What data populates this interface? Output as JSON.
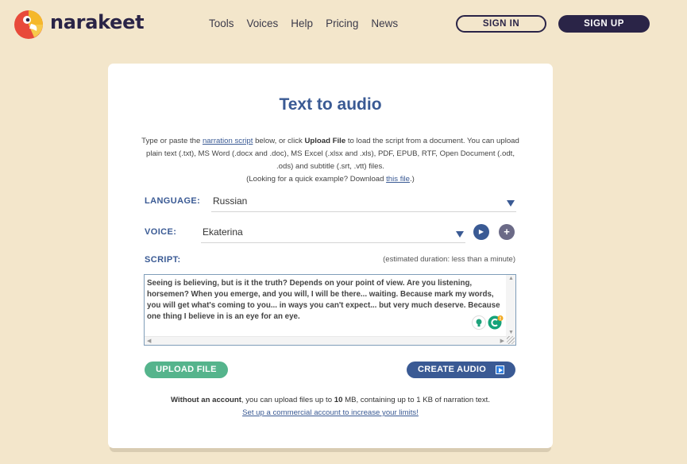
{
  "header": {
    "brand": "narakeet",
    "nav": [
      "Tools",
      "Voices",
      "Help",
      "Pricing",
      "News"
    ],
    "sign_in": "SIGN IN",
    "sign_up": "SIGN UP"
  },
  "card": {
    "title": "Text to audio",
    "intro": {
      "p1_before": "Type or paste the ",
      "p1_link": "narration script",
      "p1_mid": " below, or click ",
      "p1_bold": "Upload File",
      "p1_after": " to load the script from a document. You can upload plain text (.txt), MS Word (.docx and .doc), MS Excel (.xlsx and .xls), PDF, EPUB, RTF, Open Document (.odt, .ods) and subtitle (.srt, .vtt) files.",
      "p2_before": "(Looking for a quick example? Download ",
      "p2_link": "this file",
      "p2_after": ".)"
    },
    "language": {
      "label": "LANGUAGE:",
      "value": "Russian"
    },
    "voice": {
      "label": "VOICE:",
      "value": "Ekaterina"
    },
    "script": {
      "label": "SCRIPT:",
      "duration": "(estimated duration: less than a minute)",
      "text": "Seeing is believing, but is it the truth? Depends on your point of view. Are you listening, horsemen? When you emerge, and you will, I will be there... waiting. Because mark my words, you will get what's coming to you... in ways you can't expect... but very much deserve. Because one thing I believe in is an eye for an eye."
    },
    "upload_button": "UPLOAD FILE",
    "create_button": "CREATE AUDIO",
    "footnote": {
      "bold": "Without an account",
      "mid": ", you can upload files up to ",
      "size1": "10",
      "mid2": " MB, containing up to 1 KB of narration text.",
      "link": "Set up a commercial account to increase your limits!"
    }
  },
  "colors": {
    "background": "#f3e6cb",
    "brand_dark": "#2a2447",
    "accent_blue": "#3a5a94",
    "upload_green": "#55b48c"
  }
}
